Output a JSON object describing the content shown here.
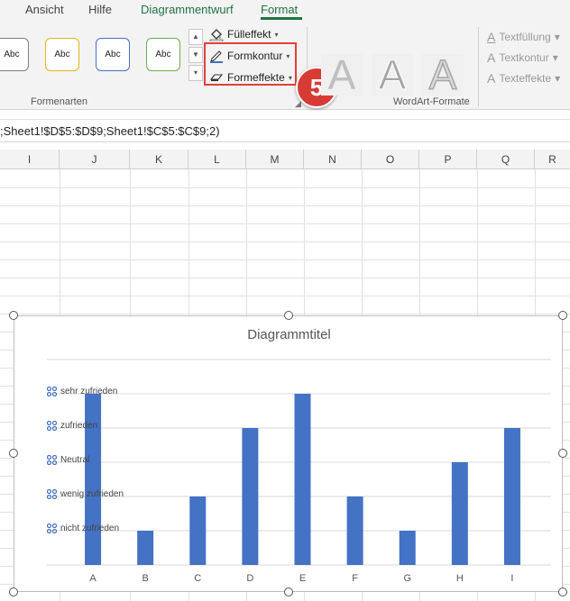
{
  "tabs": {
    "ansicht": "Ansicht",
    "hilfe": "Hilfe",
    "diagrammentwurf": "Diagrammentwurf",
    "format": "Format"
  },
  "ribbon": {
    "shape_styles": {
      "samples": [
        "Abc",
        "Abc",
        "Abc",
        "Abc"
      ],
      "colors": [
        "#7f7f7f",
        "#e7b416",
        "#4472c4",
        "#70ad47"
      ],
      "label": "Formenarten"
    },
    "commands": {
      "fill": "Fülleffekt",
      "outline": "Formkontur",
      "effects": "Formeffekte"
    },
    "wordart": {
      "label": "WordArt-Formate",
      "text_fill": "Textfüllung",
      "text_outline": "Textkontur",
      "text_effects": "Texteffekte"
    },
    "step_badge": "5"
  },
  "formula_bar": {
    "text": ";Sheet1!$D$5:$D$9;Sheet1!$C$5:$C$9;2)"
  },
  "columns": [
    "I",
    "J",
    "K",
    "L",
    "M",
    "N",
    "O",
    "P",
    "Q",
    "R"
  ],
  "chart_data": {
    "type": "bar",
    "title": "Diagrammtitel",
    "categories": [
      "A",
      "B",
      "C",
      "D",
      "E",
      "F",
      "G",
      "H",
      "I"
    ],
    "values": [
      5,
      1,
      2,
      4,
      5,
      2,
      1,
      3,
      4
    ],
    "ylim": [
      0,
      5
    ],
    "y_labels": [
      "nicht zufrieden",
      "wenig zufrieden",
      "Neutral",
      "zufrieden",
      "sehr zufrieden"
    ],
    "bar_color": "#4472c4",
    "grid": true
  }
}
